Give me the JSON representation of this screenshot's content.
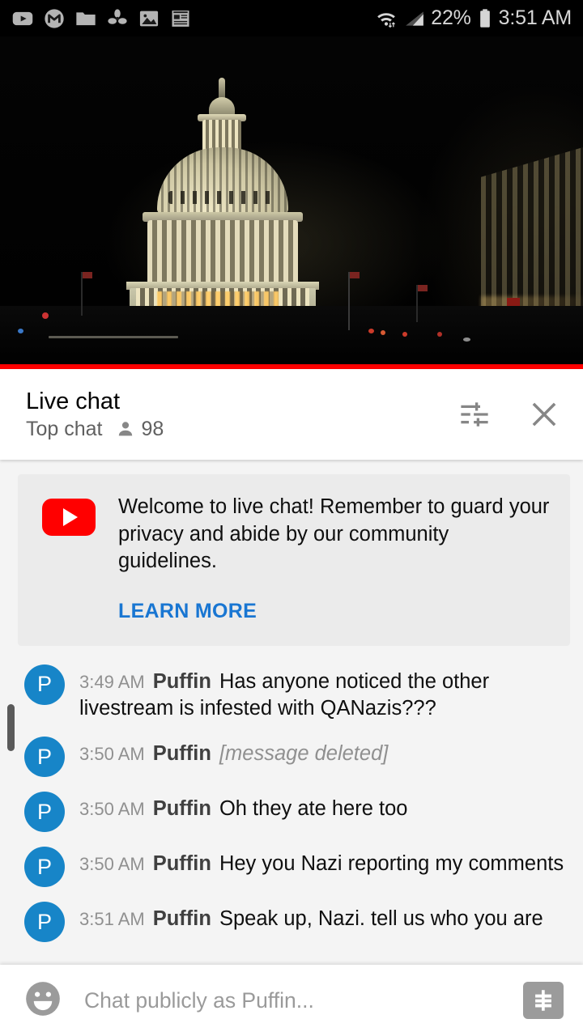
{
  "status_bar": {
    "notification_icons": [
      "youtube-icon",
      "gmail-icon",
      "folder-icon",
      "pinwheel-icon",
      "photos-icon",
      "news-icon"
    ],
    "wifi_icon": "wifi-data-icon",
    "signal_icon": "cell-signal-icon",
    "battery_percent": "22%",
    "battery_icon": "battery-icon",
    "time": "3:51 AM"
  },
  "video": {
    "description": "US Capitol dome illuminated at night livestream",
    "progress_percent": 100,
    "progress_color": "#ff0000"
  },
  "chat_header": {
    "title": "Live chat",
    "mode": "Top chat",
    "viewer_icon": "person-icon",
    "viewer_count": "98",
    "settings_icon": "tune-sliders-icon",
    "close_icon": "close-x-icon"
  },
  "welcome_banner": {
    "logo": "youtube-play-logo",
    "message": "Welcome to live chat! Remember to guard your privacy and abide by our community guidelines.",
    "learn_more_label": "LEARN MORE",
    "link_color": "#1976d2"
  },
  "messages": [
    {
      "avatar_initial": "P",
      "avatar_color": "#1785c8",
      "time": "3:49 AM",
      "author": "Puffin",
      "text": "Has anyone noticed the other livestream is infested with QANazis???",
      "deleted": false
    },
    {
      "avatar_initial": "P",
      "avatar_color": "#1785c8",
      "time": "3:50 AM",
      "author": "Puffin",
      "text": "[message deleted]",
      "deleted": true
    },
    {
      "avatar_initial": "P",
      "avatar_color": "#1785c8",
      "time": "3:50 AM",
      "author": "Puffin",
      "text": "Oh they ate here too",
      "deleted": false
    },
    {
      "avatar_initial": "P",
      "avatar_color": "#1785c8",
      "time": "3:50 AM",
      "author": "Puffin",
      "text": "Hey you Nazi reporting my comments",
      "deleted": false
    },
    {
      "avatar_initial": "P",
      "avatar_color": "#1785c8",
      "time": "3:51 AM",
      "author": "Puffin",
      "text": "Speak up, Nazi. tell us who you are",
      "deleted": false
    }
  ],
  "input_bar": {
    "emoji_icon": "emoji-smiley-icon",
    "placeholder": "Chat publicly as Puffin...",
    "value": "",
    "superchat_icon": "dollar-superchat-icon"
  }
}
